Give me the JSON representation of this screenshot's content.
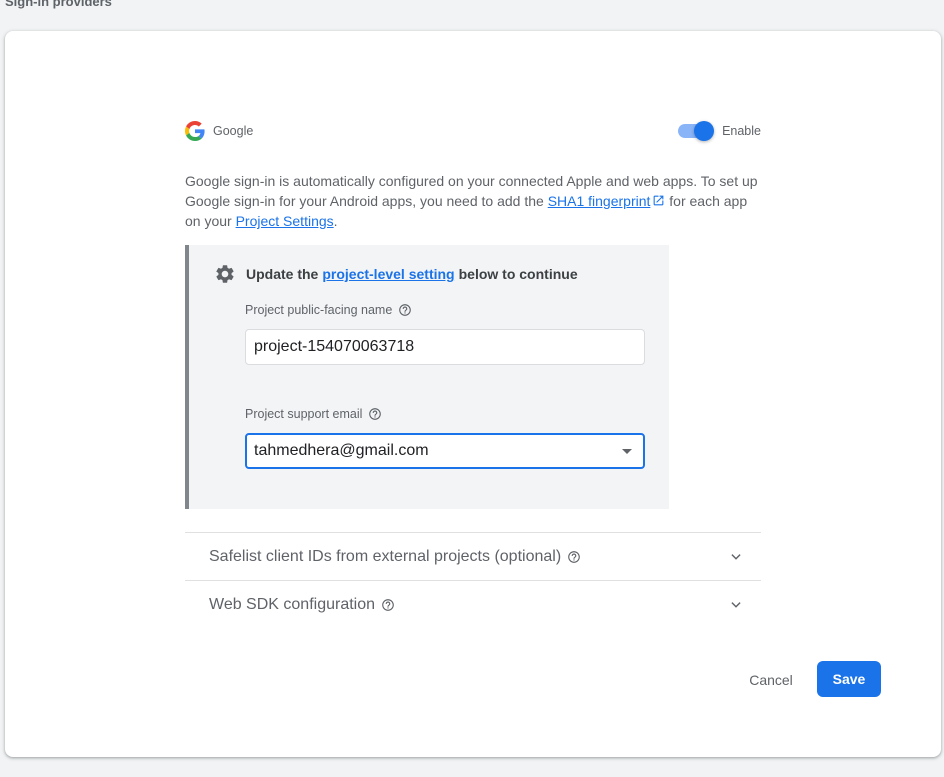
{
  "header": {
    "title": "Sign-in providers"
  },
  "provider": {
    "name": "Google",
    "logo_icon": "google-g-icon",
    "enable_label": "Enable",
    "enabled": true
  },
  "description": {
    "part1": "Google sign-in is automatically configured on your connected Apple and web apps. To set up Google sign-in for your Android apps, you need to add the ",
    "link1": "SHA1 fingerprint",
    "part2": " for each app on your ",
    "link2": "Project Settings",
    "part3": "."
  },
  "notice": {
    "prefix": "Update the",
    "link": "project-level setting",
    "suffix": "below to continue",
    "public_name_label": "Project public-facing name",
    "public_name_value": "project-154070063718",
    "support_email_label": "Project support email",
    "support_email_value": "tahmedhera@gmail.com"
  },
  "expanders": [
    {
      "label": "Safelist client IDs from external projects (optional)"
    },
    {
      "label": "Web SDK configuration"
    }
  ],
  "actions": {
    "cancel_label": "Cancel",
    "save_label": "Save"
  },
  "colors": {
    "accent": "#1a73e8",
    "toggle_track": "#8ab4f8",
    "notice_border": "#80868b"
  }
}
